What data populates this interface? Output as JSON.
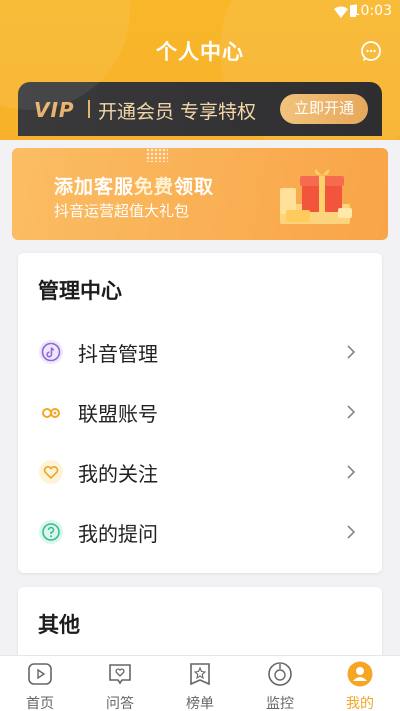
{
  "status_bar": {
    "time": "10:03"
  },
  "header": {
    "title": "个人中心"
  },
  "vip": {
    "tag": "VIP",
    "text": "开通会员 专享特权",
    "button": "立即开通"
  },
  "banner": {
    "title_pre": "添加客服",
    "title_accent": "免费",
    "title_post": "领取",
    "subtitle": "抖音运营超值大礼包"
  },
  "manage": {
    "title": "管理中心",
    "items": [
      {
        "label": "抖音管理",
        "icon": "tiktok-icon"
      },
      {
        "label": "联盟账号",
        "icon": "link-icon"
      },
      {
        "label": "我的关注",
        "icon": "heart-icon"
      },
      {
        "label": "我的提问",
        "icon": "question-icon"
      }
    ]
  },
  "other": {
    "title": "其他"
  },
  "tabs": [
    {
      "label": "首页",
      "icon": "home-play-icon"
    },
    {
      "label": "问答",
      "icon": "qa-heart-icon"
    },
    {
      "label": "榜单",
      "icon": "rank-star-icon"
    },
    {
      "label": "监控",
      "icon": "monitor-ring-icon"
    },
    {
      "label": "我的",
      "icon": "user-icon",
      "active": true
    }
  ],
  "colors": {
    "brand": "#f7b12a",
    "vip_gold": "#e8b46c",
    "active_tab": "#f5a623"
  }
}
